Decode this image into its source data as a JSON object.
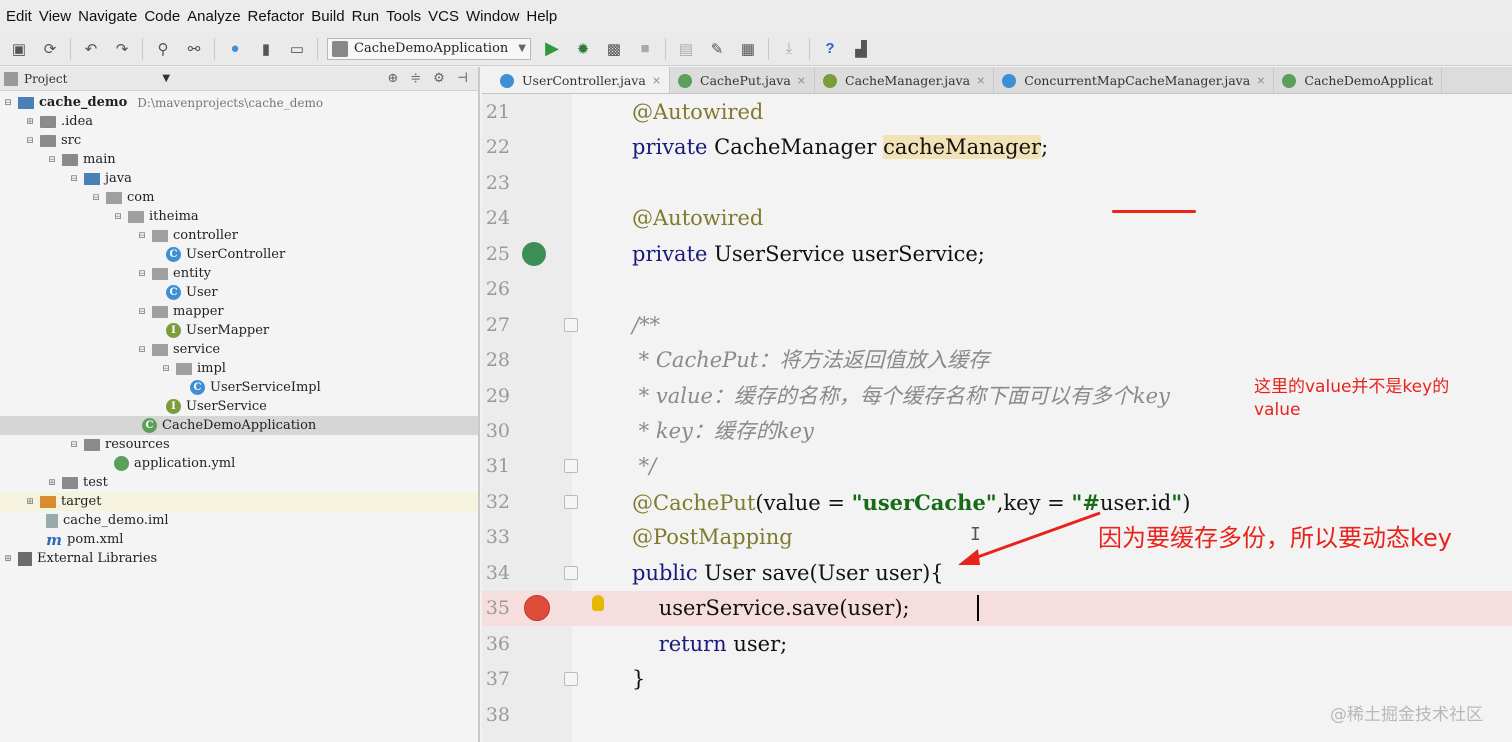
{
  "menu": [
    "Edit",
    "View",
    "Navigate",
    "Code",
    "Analyze",
    "Refactor",
    "Build",
    "Run",
    "Tools",
    "VCS",
    "Window",
    "Help"
  ],
  "toolbar": {
    "run_config": "CacheDemoApplication"
  },
  "project": {
    "header": "Project",
    "tree": [
      {
        "label": "cache_demo",
        "path": "D:\\mavenprojects\\cache_demo"
      },
      {
        "label": ".idea"
      },
      {
        "label": "src"
      },
      {
        "label": "main"
      },
      {
        "label": "java"
      },
      {
        "label": "com"
      },
      {
        "label": "itheima"
      },
      {
        "label": "controller"
      },
      {
        "label": "UserController"
      },
      {
        "label": "entity"
      },
      {
        "label": "User"
      },
      {
        "label": "mapper"
      },
      {
        "label": "UserMapper"
      },
      {
        "label": "service"
      },
      {
        "label": "impl"
      },
      {
        "label": "UserServiceImpl"
      },
      {
        "label": "UserService"
      },
      {
        "label": "CacheDemoApplication"
      },
      {
        "label": "resources"
      },
      {
        "label": "application.yml"
      },
      {
        "label": "test"
      },
      {
        "label": "target"
      },
      {
        "label": "cache_demo.iml"
      },
      {
        "label": "pom.xml"
      },
      {
        "label": "External Libraries"
      }
    ]
  },
  "tabs": [
    {
      "label": "UserController.java",
      "color": "#3f8fd4"
    },
    {
      "label": "CachePut.java",
      "color": "#5aa05a"
    },
    {
      "label": "CacheManager.java",
      "color": "#7c9c3a"
    },
    {
      "label": "ConcurrentMapCacheManager.java",
      "color": "#3f8fd4"
    },
    {
      "label": "CacheDemoApplicat",
      "color": "#5aa05a"
    }
  ],
  "code": {
    "line_numbers": [
      "21",
      "22",
      "23",
      "24",
      "25",
      "26",
      "27",
      "28",
      "29",
      "30",
      "31",
      "32",
      "33",
      "34",
      "35",
      "36",
      "37",
      "38"
    ],
    "l21": "@Autowired",
    "l22_kw": "private",
    "l22_type": " CacheManager ",
    "l22_var": "cacheManager",
    "l22_end": ";",
    "l24": "@Autowired",
    "l25_kw": "private",
    "l25_rest": " UserService userService;",
    "l27": "/**",
    "l28": " * CachePut：将方法返回值放入缓存",
    "l29": " * value：缓存的名称，每个缓存名称下面可以有多个key",
    "l30": " * key：缓存的key",
    "l31": " */",
    "l32_ann": "@CachePut",
    "l32_a": "(value = ",
    "l32_s1": "\"userCache\"",
    "l32_b": ",key = ",
    "l32_s2": "\"#",
    "l32_c": "user.id",
    "l32_s3": "\"",
    "l32_d": ")",
    "l33": "@PostMapping",
    "l34_kw": "public",
    "l34_rest": " User save(User user){",
    "l35": "    userService.save(user);",
    "l36_kw": "    return",
    "l36_rest": " user;",
    "l37": "}"
  },
  "annotations": {
    "note1": "这里的value并不是key的value",
    "note2": "因为要缓存多份，所以要动态key",
    "watermark": "@稀土掘金技术社区"
  }
}
